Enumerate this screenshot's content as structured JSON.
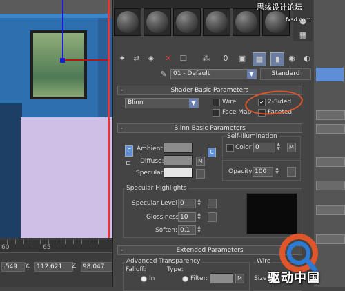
{
  "viewport": {
    "ruler_labels": [
      "60",
      "65"
    ]
  },
  "statusbar": {
    "x_value": ".549",
    "y_label": "Y:",
    "y_value": "112.621",
    "z_label": "Z:",
    "z_value": "98.047"
  },
  "material_editor": {
    "material_name": "01 - Default",
    "material_type": "Standard",
    "shader_basic": {
      "title": "Shader Basic Parameters",
      "shader": "Blinn",
      "wire": "Wire",
      "two_sided": "2-Sided",
      "two_sided_checked": true,
      "face_map": "Face Map",
      "faceted": "Faceted"
    },
    "blinn_basic": {
      "title": "Blinn Basic Parameters",
      "self_illum_title": "Self-Illumination",
      "color_label": "Color",
      "self_illum_value": "0",
      "ambient_label": "Ambient:",
      "diffuse_label": "Diffuse:",
      "specular_label": "Specular:",
      "map_btn": "M",
      "lock_btn": "C",
      "opacity_label": "Opacity:",
      "opacity_value": "100",
      "colors": {
        "ambient": "#8c8c8c",
        "diffuse": "#8c8c8c",
        "specular": "#e6e6e6"
      }
    },
    "specular_highlights": {
      "title": "Specular Highlights",
      "level_label": "Specular Level:",
      "level_value": "0",
      "gloss_label": "Glossiness:",
      "gloss_value": "10",
      "soften_label": "Soften:",
      "soften_value": "0.1"
    },
    "extended": {
      "title": "Extended Parameters",
      "adv_transparency": "Advanced Transparency",
      "falloff": "Falloff:",
      "type": "Type:",
      "in": "In",
      "filter": "Filter:",
      "wire": "Wire",
      "size": "Size",
      "map_btn": "M"
    },
    "rollout_minus": "-"
  },
  "watermark": {
    "text": "驱动中国",
    "top_text": "思缘设计论坛",
    "site": "fxsd.com",
    "logo_colors": [
      "#e0552a",
      "#2b7bd6"
    ]
  }
}
